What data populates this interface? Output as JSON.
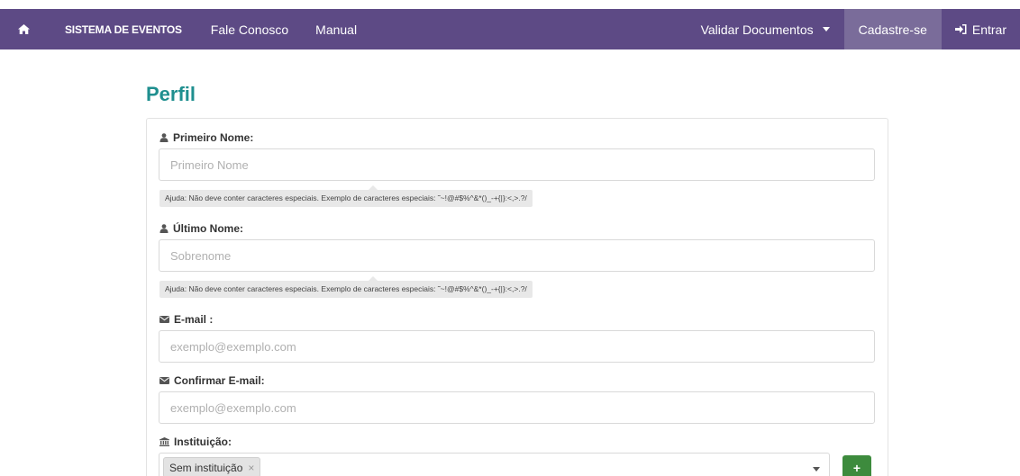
{
  "navbar": {
    "home_icon": "home-icon",
    "brand": "SISTEMA DE EVENTOS",
    "links": [
      "Fale Conosco",
      "Manual"
    ],
    "validate": "Validar Documentos",
    "register": "Cadastre-se",
    "login": "Entrar",
    "bg_color": "#5d4a85",
    "active_color": "#7a6c9a"
  },
  "page": {
    "title": "Perfil",
    "title_color": "#1f8f8f"
  },
  "form": {
    "first_name": {
      "label": "Primeiro Nome:",
      "placeholder": "Primeiro Nome",
      "help": "Ajuda: Não deve conter caracteres especiais. Exemplo de caracteres especiais: ˜~!@#$%^&*()_-+{|}:<,>.?/"
    },
    "last_name": {
      "label": "Último Nome:",
      "placeholder": "Sobrenome",
      "help": "Ajuda: Não deve conter caracteres especiais. Exemplo de caracteres especiais: ˜~!@#$%^&*()_-+{|}:<,>.?/"
    },
    "email": {
      "label": "E-mail :",
      "placeholder": "exemplo@exemplo.com"
    },
    "confirm_email": {
      "label": "Confirmar E-mail:",
      "placeholder": "exemplo@exemplo.com"
    },
    "institution": {
      "label": "Instituição:",
      "selected": "Sem instituição",
      "remove_symbol": "×",
      "add_symbol": "+",
      "add_color": "#3d8b3d"
    }
  }
}
